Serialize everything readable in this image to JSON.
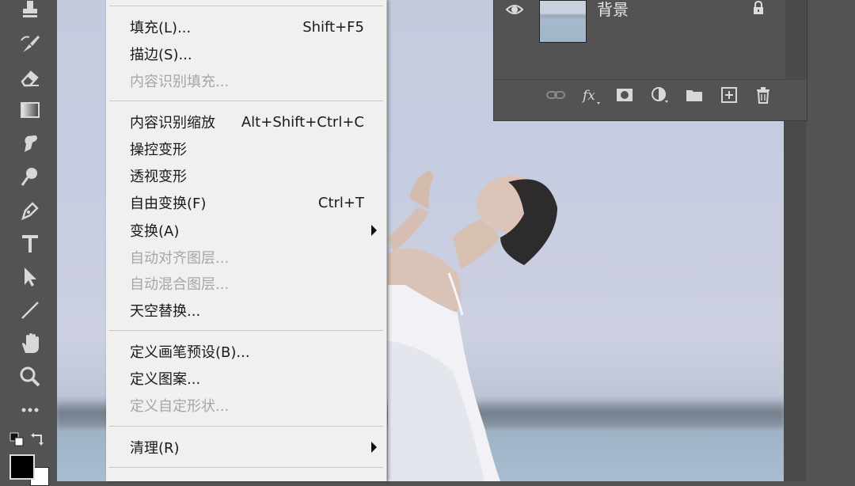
{
  "menu": {
    "items": [
      {
        "label": "填充(L)...",
        "shortcut": "Shift+F5",
        "enabled": true
      },
      {
        "label": "描边(S)...",
        "shortcut": "",
        "enabled": true
      },
      {
        "label": "内容识别填充...",
        "shortcut": "",
        "enabled": false
      },
      {
        "label": "内容识别缩放",
        "shortcut": "Alt+Shift+Ctrl+C",
        "enabled": true
      },
      {
        "label": "操控变形",
        "shortcut": "",
        "enabled": true
      },
      {
        "label": "透视变形",
        "shortcut": "",
        "enabled": true
      },
      {
        "label": "自由变换(F)",
        "shortcut": "Ctrl+T",
        "enabled": true
      },
      {
        "label": "变换(A)",
        "shortcut": "",
        "enabled": true,
        "submenu": true
      },
      {
        "label": "自动对齐图层...",
        "shortcut": "",
        "enabled": false
      },
      {
        "label": "自动混合图层...",
        "shortcut": "",
        "enabled": false
      },
      {
        "label": "天空替换...",
        "shortcut": "",
        "enabled": true
      },
      {
        "label": "定义画笔预设(B)...",
        "shortcut": "",
        "enabled": true
      },
      {
        "label": "定义图案...",
        "shortcut": "",
        "enabled": true
      },
      {
        "label": "定义自定形状...",
        "shortcut": "",
        "enabled": false
      },
      {
        "label": "清理(R)",
        "shortcut": "",
        "enabled": true,
        "submenu": true
      }
    ]
  },
  "layers": {
    "layer_name": "背景",
    "tools": [
      "link-icon",
      "fx-icon",
      "mask-icon",
      "adjustment-icon",
      "folder-icon",
      "new-layer-icon",
      "trash-icon"
    ]
  },
  "toolbar": {
    "tools": [
      "stamp-icon",
      "history-brush-icon",
      "eraser-icon",
      "gradient-icon",
      "smudge-icon",
      "dodge-icon",
      "pen-icon",
      "type-icon",
      "path-select-icon",
      "line-icon",
      "hand-icon",
      "zoom-icon",
      "more-icon"
    ]
  },
  "colors": {
    "menu_bg": "#f0f0f0",
    "panel_bg": "#535353",
    "disabled_text": "#a6a6a6"
  }
}
